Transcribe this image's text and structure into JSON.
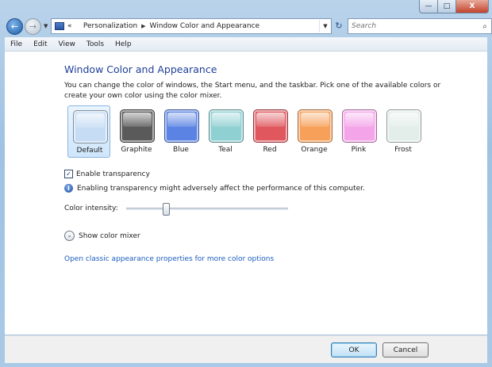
{
  "window": {
    "caption": {
      "minimize": "—",
      "maximize": "□",
      "close": "X"
    }
  },
  "nav": {
    "back_glyph": "←",
    "forward_glyph": "→",
    "dropdown_glyph": "▼",
    "breadcrumb_lead": "«",
    "breadcrumb": [
      "Personalization",
      "Window Color and Appearance"
    ],
    "breadcrumb_separator": "▶",
    "refresh_glyph": "↻",
    "search_placeholder": "Search",
    "search_glyph": "⌕"
  },
  "menu": [
    "File",
    "Edit",
    "View",
    "Tools",
    "Help"
  ],
  "content": {
    "title": "Window Color and Appearance",
    "description": "You can change the color of windows, the Start menu, and the taskbar. Pick one of the available colors or create your own color using the color mixer.",
    "swatches": [
      {
        "label": "Default",
        "color": "#c6dcf4",
        "selected": true
      },
      {
        "label": "Graphite",
        "color": "#5a5a5a",
        "selected": false
      },
      {
        "label": "Blue",
        "color": "#5b83e4",
        "selected": false
      },
      {
        "label": "Teal",
        "color": "#8fd0d2",
        "selected": false
      },
      {
        "label": "Red",
        "color": "#e0575e",
        "selected": false
      },
      {
        "label": "Orange",
        "color": "#f7a05a",
        "selected": false
      },
      {
        "label": "Pink",
        "color": "#f4a4e9",
        "selected": false
      },
      {
        "label": "Frost",
        "color": "#e3eeea",
        "selected": false
      }
    ],
    "transparency": {
      "label": "Enable transparency",
      "checked": true,
      "check_glyph": "✓"
    },
    "info": {
      "glyph": "i",
      "text": "Enabling transparency might adversely affect the performance of this computer."
    },
    "intensity": {
      "label": "Color intensity:",
      "value_fraction": 0.24
    },
    "mixer": {
      "glyph": "⌄",
      "label": "Show color mixer"
    },
    "classic_link": "Open classic appearance properties for more color options"
  },
  "footer": {
    "ok": "OK",
    "cancel": "Cancel"
  },
  "colors": {
    "title": "#1e3f99",
    "link": "#1c5dbf"
  }
}
